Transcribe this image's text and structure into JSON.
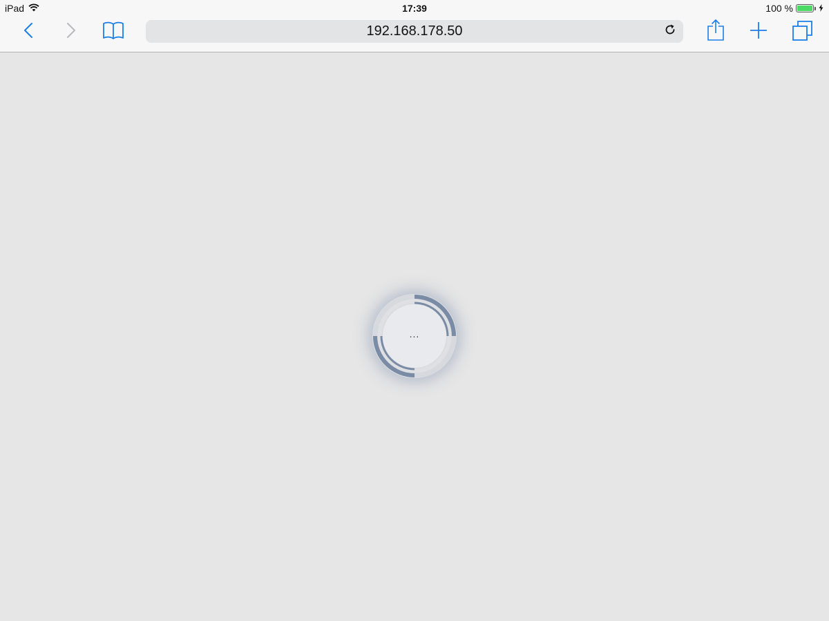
{
  "status_bar": {
    "device": "iPad",
    "time": "17:39",
    "battery_text": "100 %",
    "battery_level": 1.0
  },
  "toolbar": {
    "url": "192.168.178.50",
    "icons": {
      "back": "chevron-left-icon",
      "forward": "chevron-right-icon",
      "bookmarks": "book-icon",
      "reload": "reload-icon",
      "share": "share-icon",
      "new_tab": "plus-icon",
      "tabs": "tabs-icon"
    }
  },
  "loader": {
    "text": "..."
  },
  "colors": {
    "accent": "#1a7ee8",
    "disabled": "#b8b8bd",
    "page_background": "#e6e6e6",
    "loader_ring": "#7a8ca5"
  }
}
